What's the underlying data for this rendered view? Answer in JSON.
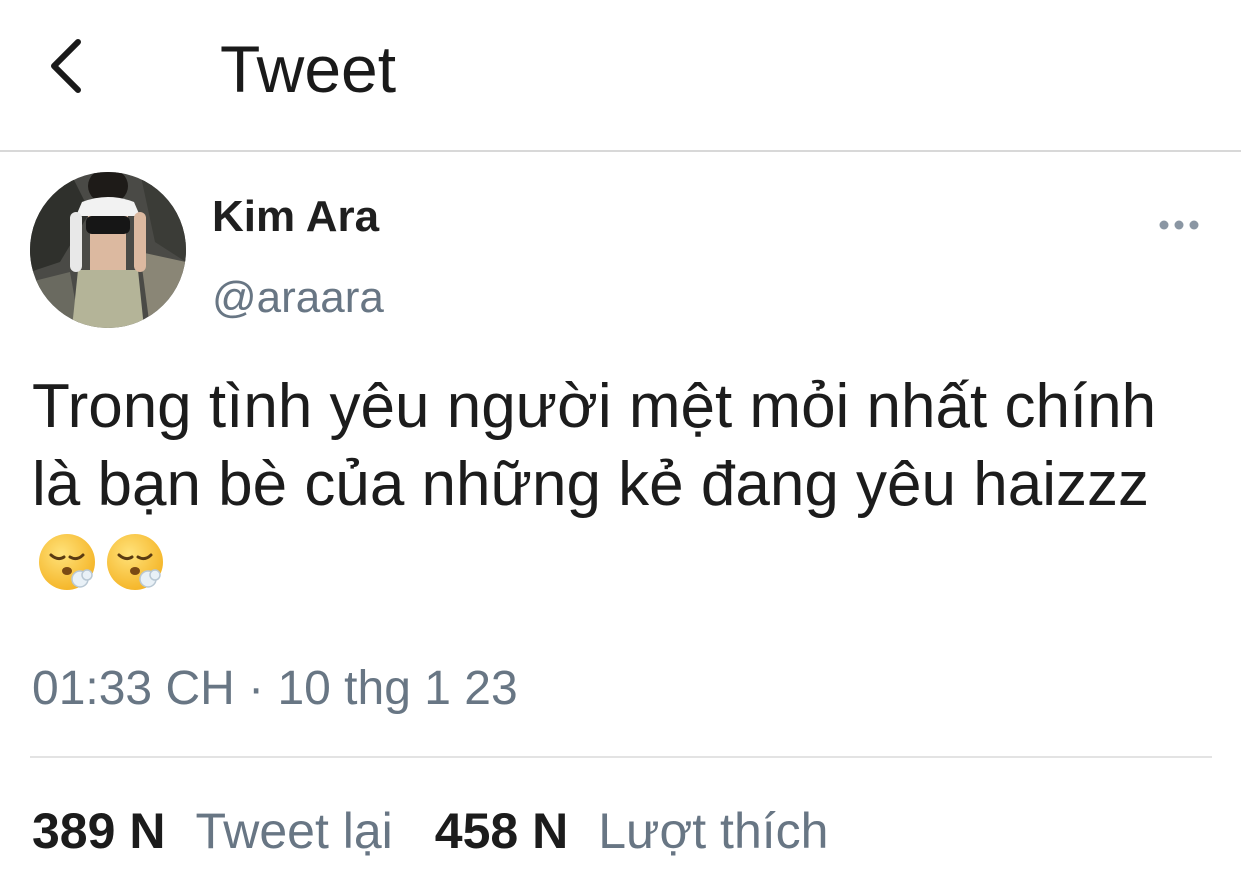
{
  "header": {
    "title": "Tweet",
    "back_icon": "chevron-left-icon"
  },
  "author": {
    "name": "Kim Ara",
    "handle": "@araara",
    "more_icon": "more-horizontal-icon"
  },
  "tweet": {
    "text": "Trong tình yêu người mệt mỏi nhất chính là bạn bè của những kẻ đang yêu haizzz",
    "emojis": [
      "face-exhaling-emoji",
      "face-exhaling-emoji"
    ],
    "timestamp": "01:33 CH · 10 thg 1 23"
  },
  "stats": {
    "retweets_count": "389 N",
    "retweets_label": "Tweet lại",
    "likes_count": "458 N",
    "likes_label": "Lượt thích"
  },
  "colors": {
    "text_primary": "#1c1c1c",
    "text_secondary": "#687684",
    "divider": "#d8d8d8",
    "background": "#ffffff"
  }
}
